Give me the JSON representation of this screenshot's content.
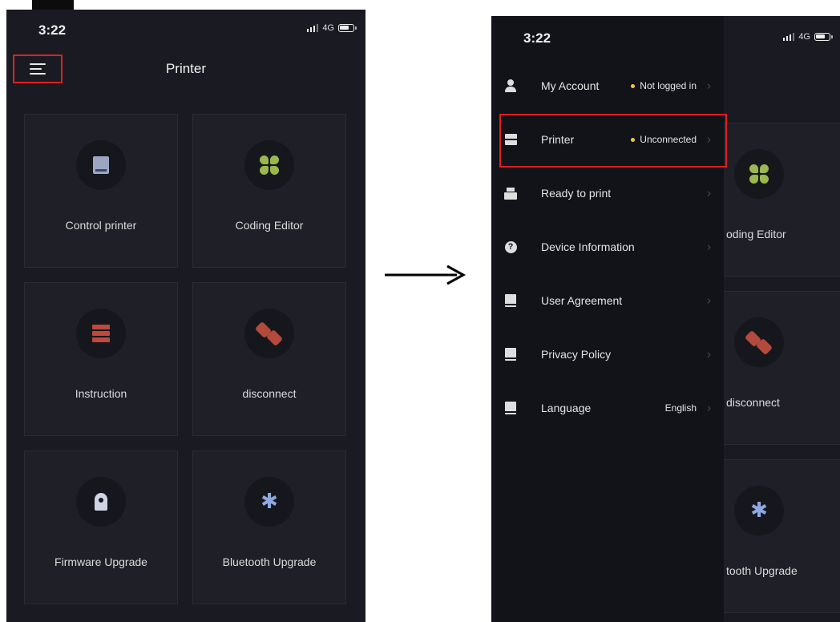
{
  "left_screen": {
    "status": {
      "time": "3:22",
      "network": "4G"
    },
    "nav": {
      "title": "Printer",
      "menu_icon": "hamburger-menu-icon"
    },
    "grid": [
      {
        "label": "Control printer",
        "icon": "printer-icon",
        "color": "#9aa6c2"
      },
      {
        "label": "Coding Editor",
        "icon": "clover-icon",
        "color": "#9ab84e"
      },
      {
        "label": "Instruction",
        "icon": "server-stack-icon",
        "color": "#c0493b"
      },
      {
        "label": "disconnect",
        "icon": "unplug-icon",
        "color": "#b34a3c"
      },
      {
        "label": "Firmware Upgrade",
        "icon": "rocket-icon",
        "color": "#cfd5e4"
      },
      {
        "label": "Bluetooth Upgrade",
        "icon": "bluetooth-icon",
        "color": "#8ea8e0"
      }
    ]
  },
  "right_screen": {
    "status": {
      "time": "3:22",
      "network": "4G"
    },
    "background_cards": [
      {
        "label": "oding Editor",
        "icon": "clover-icon"
      },
      {
        "label": "disconnect",
        "icon": "unplug-icon"
      },
      {
        "label": "tooth Upgrade",
        "icon": "bluetooth-icon"
      }
    ],
    "drawer": {
      "items": [
        {
          "label": "My Account",
          "status": "Not logged in",
          "status_dot": true,
          "icon": "user-icon"
        },
        {
          "label": "Printer",
          "status": "Unconnected",
          "status_dot": true,
          "icon": "printer-box-icon",
          "highlighted": true
        },
        {
          "label": "Ready to print",
          "status": "",
          "status_dot": false,
          "icon": "print-icon"
        },
        {
          "label": "Device Information",
          "status": "",
          "status_dot": false,
          "icon": "help-circle-icon"
        },
        {
          "label": "User Agreement",
          "status": "",
          "status_dot": false,
          "icon": "book-icon"
        },
        {
          "label": "Privacy Policy",
          "status": "",
          "status_dot": false,
          "icon": "policy-book-icon"
        },
        {
          "label": "Language",
          "status": "English",
          "status_dot": false,
          "icon": "language-book-icon"
        }
      ],
      "chevron": "›",
      "help_glyph": "?"
    }
  },
  "colors": {
    "background": "#1a1b22",
    "drawer": "#121319",
    "accent_highlight": "#e02020",
    "status_dot": "#f0c93a"
  }
}
